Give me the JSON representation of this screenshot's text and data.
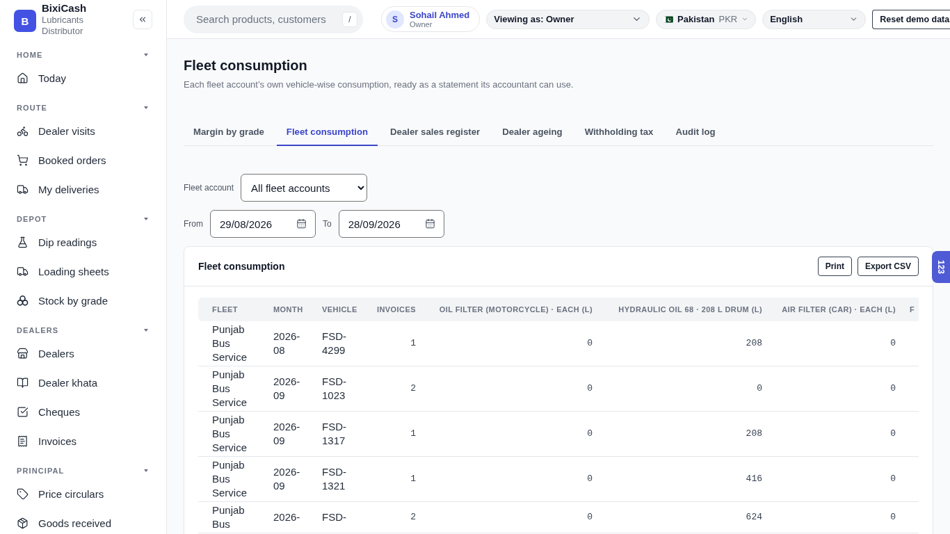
{
  "sidebar": {
    "brand": {
      "logo_letter": "B",
      "name": "BixiCash",
      "tagline": "Lubricants Distributor"
    },
    "sections": [
      {
        "title": "HOME",
        "expanded": true,
        "items": [
          {
            "label": "Today",
            "selected": false
          }
        ]
      },
      {
        "title": "ROUTE",
        "expanded": true,
        "items": [
          {
            "label": "Dealer visits",
            "selected": false
          },
          {
            "label": "Booked orders",
            "selected": false
          },
          {
            "label": "My deliveries",
            "selected": false
          }
        ]
      },
      {
        "title": "DEPOT",
        "expanded": true,
        "items": [
          {
            "label": "Dip readings",
            "selected": false
          },
          {
            "label": "Loading sheets",
            "selected": false
          },
          {
            "label": "Stock by grade",
            "selected": false
          }
        ]
      },
      {
        "title": "DEALERS",
        "expanded": true,
        "items": [
          {
            "label": "Dealers",
            "selected": false
          },
          {
            "label": "Dealer khata",
            "selected": false
          },
          {
            "label": "Cheques",
            "selected": false
          },
          {
            "label": "Invoices",
            "selected": false
          }
        ]
      },
      {
        "title": "PRINCIPAL",
        "expanded": true,
        "items": [
          {
            "label": "Price circulars",
            "selected": false
          },
          {
            "label": "Goods received",
            "selected": false
          }
        ]
      }
    ]
  },
  "topbar": {
    "search": {
      "placeholder": "Search products, customers",
      "shortcut": "/"
    },
    "user": {
      "initial": "S",
      "name": "Sohail Ahmed",
      "role": "Owner"
    },
    "view_as": "Viewing as: Owner",
    "region": {
      "country": "Pakistan",
      "currency": "PKR"
    },
    "language": "English",
    "reset_button": "Reset demo data"
  },
  "page": {
    "title": "Fleet consumption",
    "subtitle": "Each fleet account’s own vehicle-wise consumption, ready as a statement its accountant can use."
  },
  "tabs": [
    {
      "label": "Margin by grade",
      "selected": false
    },
    {
      "label": "Fleet consumption",
      "selected": true
    },
    {
      "label": "Dealer sales register",
      "selected": false
    },
    {
      "label": "Dealer ageing",
      "selected": false
    },
    {
      "label": "Withholding tax",
      "selected": false
    },
    {
      "label": "Audit log",
      "selected": false
    }
  ],
  "filters": {
    "fleet_account": {
      "label": "Fleet account",
      "value": "All fleet accounts"
    },
    "from": {
      "label": "From",
      "value": "29/08/2026"
    },
    "to": {
      "label": "To",
      "value": "28/09/2026"
    }
  },
  "report": {
    "title": "Fleet consumption",
    "buttons": [
      "Print",
      "Export CSV"
    ],
    "columns": [
      {
        "label": "FLEET",
        "kind": "text"
      },
      {
        "label": "MONTH",
        "kind": "text"
      },
      {
        "label": "VEHICLE",
        "kind": "text"
      },
      {
        "label": "INVOICES",
        "kind": "number"
      },
      {
        "label": "OIL FILTER (MOTORCYCLE) · EACH (L)",
        "kind": "number"
      },
      {
        "label": "HYDRAULIC OIL 68 · 208 L DRUM (L)",
        "kind": "number"
      },
      {
        "label": "AIR FILTER (CAR) · EACH (L)",
        "kind": "number"
      },
      {
        "label": "F",
        "kind": "text"
      }
    ],
    "rows": [
      [
        "Punjab Bus Service",
        "2026-08",
        "FSD-4299",
        "1",
        "0",
        "208",
        "0"
      ],
      [
        "Punjab Bus Service",
        "2026-09",
        "FSD-1023",
        "2",
        "0",
        "0",
        "0"
      ],
      [
        "Punjab Bus Service",
        "2026-09",
        "FSD-1317",
        "1",
        "0",
        "208",
        "0"
      ],
      [
        "Punjab Bus Service",
        "2026-09",
        "FSD-1321",
        "1",
        "0",
        "416",
        "0"
      ],
      [
        "Punjab Bus",
        "2026-",
        "FSD-",
        "2",
        "0",
        "624",
        "0"
      ]
    ]
  },
  "keypad_button": "123"
}
